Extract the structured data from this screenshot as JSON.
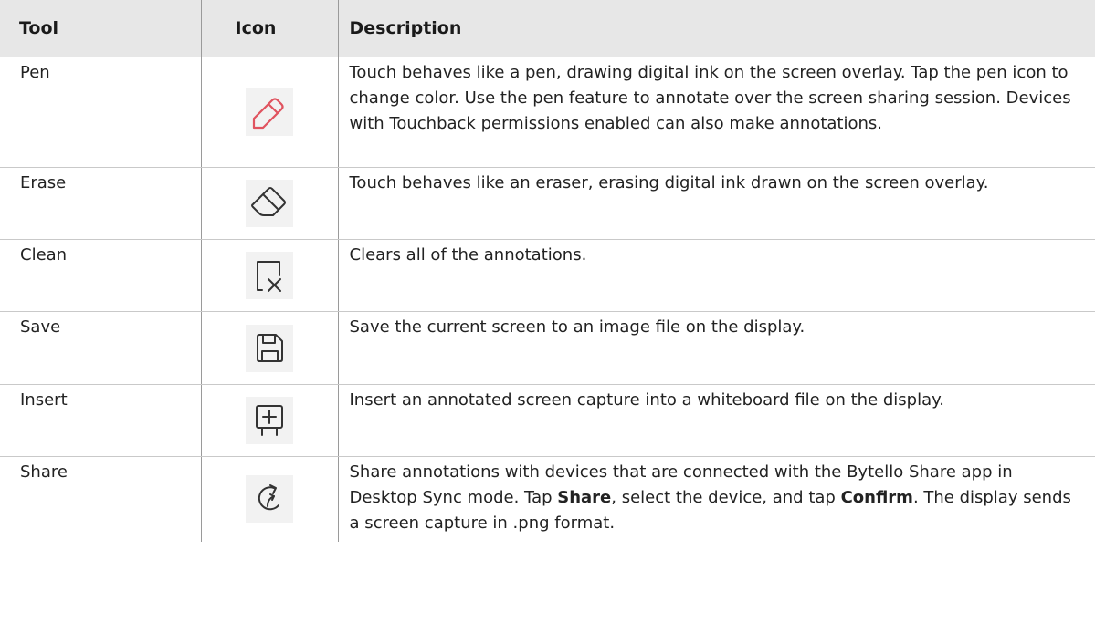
{
  "table": {
    "headers": {
      "tool": "Tool",
      "icon": "Icon",
      "description": "Description"
    },
    "rows": [
      {
        "tool": "Pen",
        "icon": "pen-icon",
        "description": "Touch behaves like a pen, drawing digital ink on the screen overlay. Tap the pen icon to change color. Use the pen feature to annotate over the screen sharing session. Devices with Touchback permissions enabled can also make annotations."
      },
      {
        "tool": "Erase",
        "icon": "eraser-icon",
        "description": "Touch behaves like an eraser, erasing digital ink drawn on the screen overlay."
      },
      {
        "tool": "Clean",
        "icon": "clean-icon",
        "description": "Clears all of the annotations."
      },
      {
        "tool": "Save",
        "icon": "save-icon",
        "description": "Save the current screen to an image file on the display."
      },
      {
        "tool": "Insert",
        "icon": "insert-whiteboard-icon",
        "description": "Insert an annotated screen capture into a whiteboard file on the display."
      },
      {
        "tool": "Share",
        "icon": "share-icon",
        "description_parts": {
          "p1": "Share annotations with devices that are connected with the Bytello Share app in Desktop Sync mode. Tap ",
          "b1": "Share",
          "p2": ", select the device, and tap ",
          "b2": "Confirm",
          "p3": ". The display sends a screen capture in .png format."
        }
      }
    ],
    "colors": {
      "header_bg": "#e7e7e7",
      "pen_icon": "#e0535f",
      "icon_stroke": "#333333",
      "icon_bg": "#f2f2f2"
    }
  }
}
